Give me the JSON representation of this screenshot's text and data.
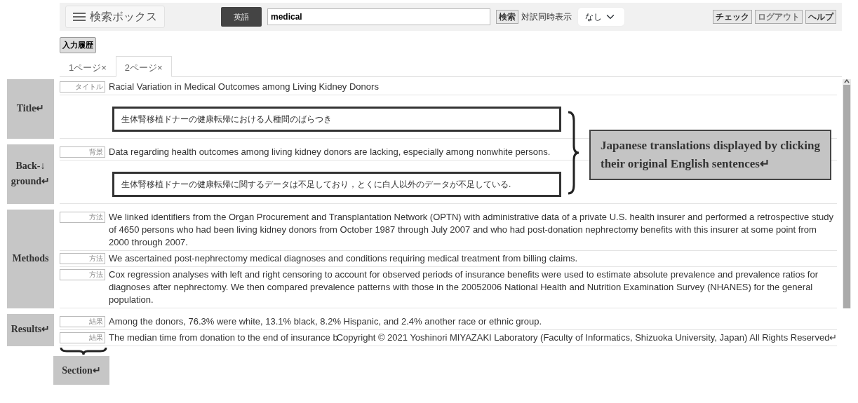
{
  "header": {
    "menu_button": "検索ボックス",
    "language_button": "英語",
    "search": {
      "value": "medical"
    },
    "search_button": "検索",
    "parallel_label": "対訳同時表示",
    "parallel_select": "なし",
    "buttons": [
      "チェック",
      "ログアウト",
      "ヘルプ"
    ]
  },
  "history_button": "入力履歴",
  "tabs": [
    {
      "label": "1ページ×",
      "selected": false
    },
    {
      "label": "2ページ×",
      "selected": true
    }
  ],
  "sections": [
    {
      "label": [
        "Title↵"
      ],
      "sentences": [
        {
          "tag": "タイトル",
          "text": "Racial Variation in Medical Outcomes among Living Kidney Donors",
          "translation": "生体腎移植ドナーの健康転帰における人種間のばらつき"
        }
      ]
    },
    {
      "label": [
        "Back-↓",
        "ground↵"
      ],
      "sentences": [
        {
          "tag": "背景",
          "text": "Data regarding health outcomes among living kidney donors are lacking, especially among nonwhite persons.",
          "translation": "生体腎移植ドナーの健康転帰に関するデータは不足しており，とくに白人以外のデータが不足している."
        }
      ]
    },
    {
      "label": [
        "Methods"
      ],
      "sentences": [
        {
          "tag": "方法",
          "text": "We linked identifiers from the Organ Procurement and Transplantation Network (OPTN) with administrative data of a private U.S. health insurer and performed a retrospective study of 4650 persons who had been living kidney donors from October 1987 through July 2007 and who had post-donation nephrectomy benefits with this insurer at some point from 2000 through 2007."
        },
        {
          "tag": "方法",
          "text": "We ascertained post-nephrectomy medical diagnoses and conditions requiring medical treatment from billing claims."
        },
        {
          "tag": "方法",
          "text": "Cox regression analyses with left and right censoring to account for observed periods of insurance benefits were used to estimate absolute prevalence and prevalence ratios for diagnoses after nephrectomy. We then compared prevalence patterns with those in the 20052006 National Health and Nutrition Examination Survey (NHANES) for the general population."
        }
      ]
    },
    {
      "label": [
        "Results↵"
      ],
      "sentences": [
        {
          "tag": "結果",
          "text": "Among the donors, 76.3% were white, 13.1% black, 8.2% Hispanic, and 2.4% another race or ethnic group."
        },
        {
          "tag": "結果",
          "text": "The median time from donation to the end of insurance b"
        }
      ]
    }
  ],
  "footer": "Copyright © 2021 Yoshinori MIYAZAKI Laboratory (Faculty of Informatics, Shizuoka University, Japan) All Rights Reserved↵",
  "annotations": {
    "callout": "Japanese translations displayed by clicking their original English sentences↵",
    "section_label": "Section↵"
  }
}
